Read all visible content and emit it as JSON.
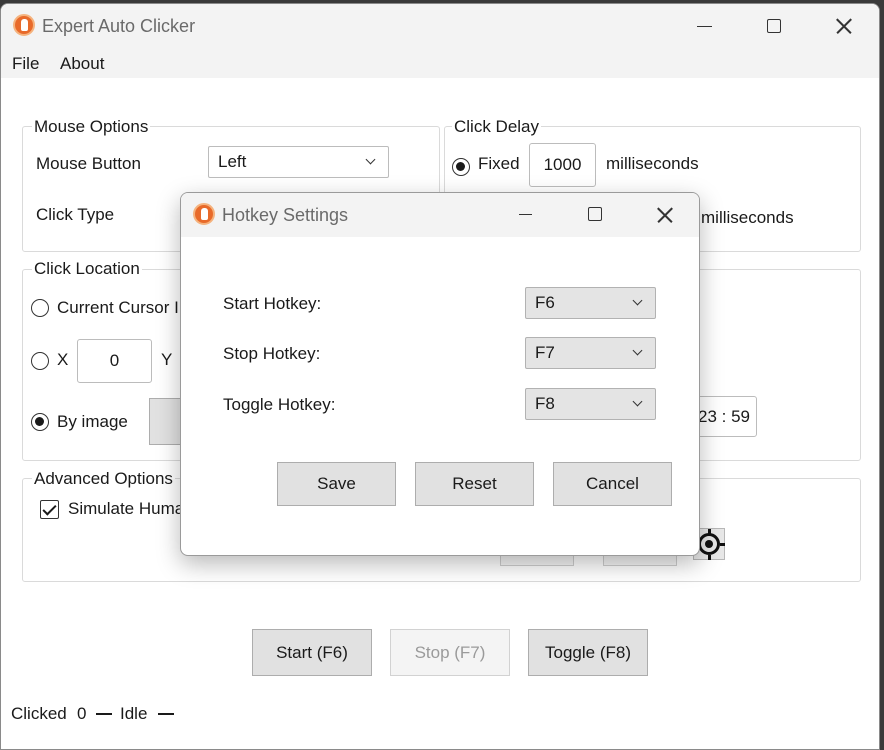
{
  "main_window": {
    "title": "Expert Auto Clicker",
    "menu": [
      "File",
      "About"
    ],
    "mouse_options": {
      "title": "Mouse Options",
      "mouse_button_label": "Mouse Button",
      "mouse_button_value": "Left",
      "click_type_label": "Click Type"
    },
    "click_delay": {
      "title": "Click Delay",
      "fixed_label": "Fixed",
      "fixed_value": "1000",
      "fixed_unit": "milliseconds",
      "random_unit": "milliseconds"
    },
    "click_location": {
      "title": "Click Location",
      "current_cursor_label": "Current Cursor I",
      "x_label": "X",
      "x_value": "0",
      "y_label": "Y",
      "by_image_label": "By image",
      "time_value": "23 : 59"
    },
    "advanced_options": {
      "title": "Advanced Options",
      "simulate_label": "Simulate Huma"
    },
    "buttons": {
      "start": "Start (F6)",
      "stop": "Stop (F7)",
      "toggle": "Toggle (F8)"
    },
    "status": {
      "clicked_label": "Clicked",
      "clicked_count": "0",
      "state": "Idle"
    }
  },
  "hotkey_dialog": {
    "title": "Hotkey Settings",
    "rows": [
      {
        "label": "Start Hotkey:",
        "value": "F6"
      },
      {
        "label": "Stop Hotkey:",
        "value": "F7"
      },
      {
        "label": "Toggle Hotkey:",
        "value": "F8"
      }
    ],
    "buttons": {
      "save": "Save",
      "reset": "Reset",
      "cancel": "Cancel"
    }
  },
  "colors": {
    "app_icon": "#e86a2a",
    "titlebar": "#f3f3f3",
    "button": "#e1e1e1"
  }
}
